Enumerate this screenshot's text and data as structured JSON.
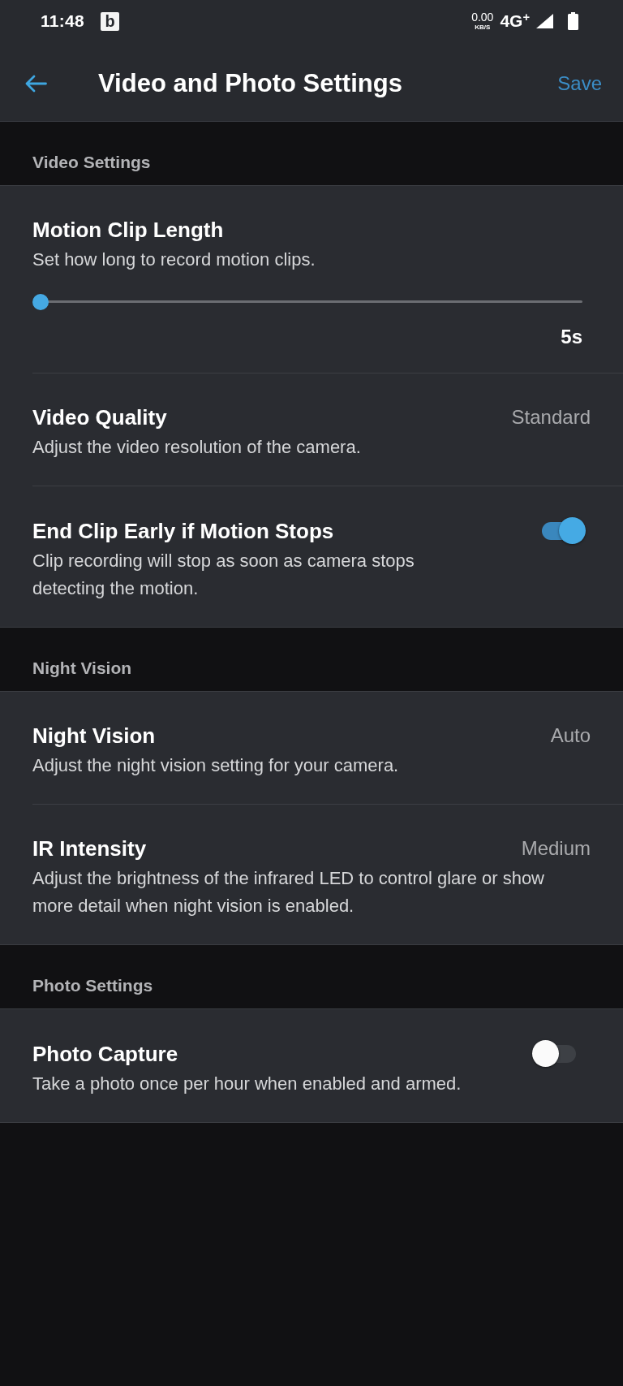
{
  "status_bar": {
    "time": "11:48",
    "notification": "b",
    "net_speed": "0.00",
    "net_unit": "KB/S",
    "network": "4G$^{+}$"
  },
  "header": {
    "title": "Video and Photo Settings",
    "action": "Save"
  },
  "sections": [
    {
      "title": "Video Settings",
      "items": [
        {
          "kind": "slider",
          "title": "Motion Clip Length",
          "description": "Set how long to record motion clips.",
          "level": 0,
          "reading": "5s"
        },
        {
          "kind": "value",
          "title": "Video Quality",
          "description": "Adjust the video resolution of the camera.",
          "value": "Standard"
        },
        {
          "kind": "toggle",
          "title": "End Clip Early if Motion Stops",
          "description": "Clip recording will stop as soon as camera stops detecting the motion.",
          "on": true
        }
      ]
    },
    {
      "title": "Night Vision",
      "items": [
        {
          "kind": "value",
          "title": "Night Vision",
          "description": "Adjust the night vision setting for your camera.",
          "value": "Auto"
        },
        {
          "kind": "value",
          "title": "IR Intensity",
          "description": "Adjust the brightness of the infrared LED to control glare or show more detail when night vision is enabled.",
          "value": "Medium"
        }
      ]
    },
    {
      "title": "Photo Settings",
      "items": [
        {
          "kind": "toggle",
          "title": "Photo Capture",
          "description": "Take a photo once per hour when enabled and armed.",
          "on": false
        }
      ]
    }
  ]
}
